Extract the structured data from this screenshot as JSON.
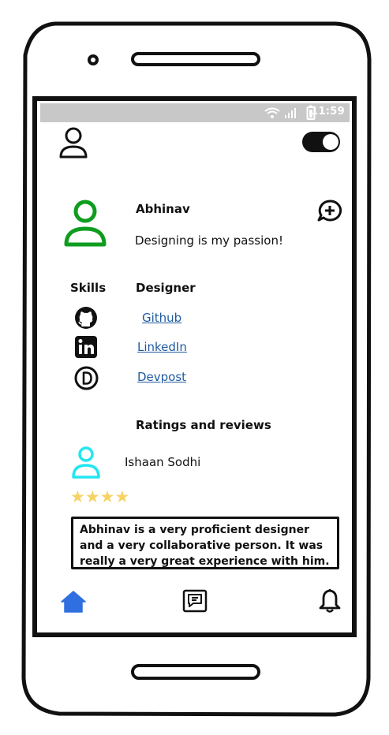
{
  "status_bar": {
    "time": "11:59"
  },
  "profile": {
    "name": "Abhinav",
    "tagline": "Designing is my passion!",
    "skills_label": "Skills",
    "skill_value": "Designer",
    "links": [
      {
        "label": "Github",
        "icon": "github-icon"
      },
      {
        "label": "LinkedIn",
        "icon": "linkedin-icon"
      },
      {
        "label": "Devpost",
        "icon": "devpost-icon"
      }
    ]
  },
  "reviews": {
    "heading": "Ratings and reviews",
    "reviewer_name": "Ishaan Sodhi",
    "stars": "★★★★",
    "rating": 4,
    "text": "Abhinav is a very proficient designer and a very collaborative person. It was really a very great experience with him."
  },
  "colors": {
    "avatar_main": "#0f9d1f",
    "avatar_reviewer": "#22e6f0",
    "home_active": "#2f6fe0",
    "link": "#1f5b9e",
    "star": "#f6d365",
    "status_bar": "#c8c8c8"
  },
  "icons": [
    "user-icon",
    "toggle-switch",
    "add-comment-icon",
    "home-icon",
    "chat-icon",
    "bell-icon",
    "wifi-icon",
    "signal-icon",
    "battery-icon"
  ]
}
